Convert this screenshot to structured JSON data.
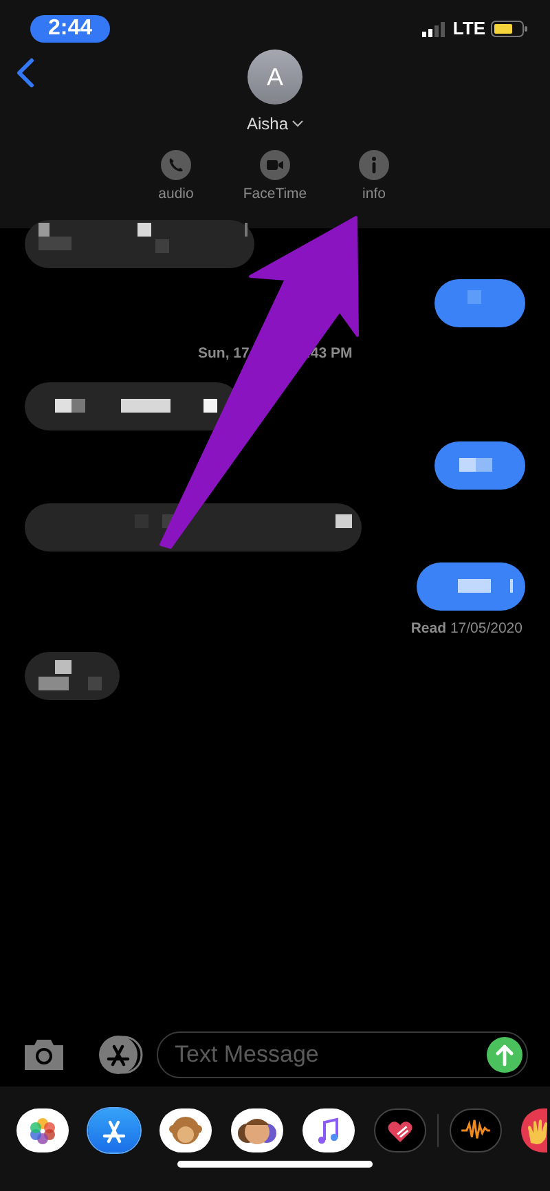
{
  "status_bar": {
    "time": "2:44",
    "network": "LTE"
  },
  "header": {
    "avatar_initial": "A",
    "contact_name": "Aisha",
    "actions": [
      {
        "kind": "audio",
        "label": "audio"
      },
      {
        "kind": "facetime",
        "label": "FaceTime"
      },
      {
        "kind": "info",
        "label": "info"
      }
    ]
  },
  "messages": [
    {
      "kind": "received"
    },
    {
      "kind": "sent"
    },
    {
      "kind": "timestamp",
      "parts": [
        "Sun, 17",
        ":43 PM"
      ]
    },
    {
      "kind": "received"
    },
    {
      "kind": "sent"
    },
    {
      "kind": "received"
    },
    {
      "kind": "sent"
    },
    {
      "kind": "receipt",
      "label": "Read",
      "date": "17/05/2020"
    },
    {
      "kind": "received"
    }
  ],
  "composer": {
    "placeholder": "Text Message"
  },
  "app_drawer": [
    {
      "kind": "photos"
    },
    {
      "kind": "appstore",
      "selected": true
    },
    {
      "kind": "animoji"
    },
    {
      "kind": "memoji"
    },
    {
      "kind": "music"
    },
    {
      "kind": "heart"
    },
    {
      "kind": "audio"
    },
    {
      "kind": "hand"
    }
  ]
}
